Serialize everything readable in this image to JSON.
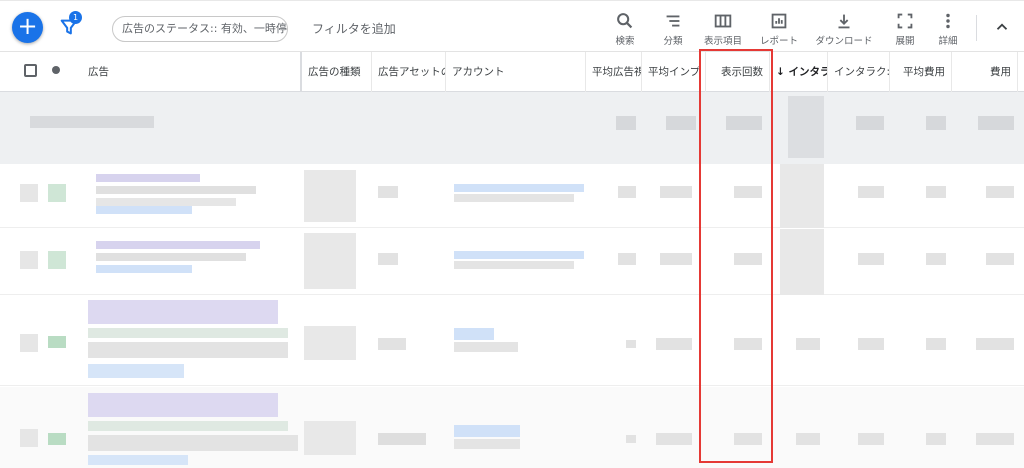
{
  "toolbar": {
    "add_icon": "plus-icon",
    "filter_badge": "1",
    "status_filter": "広告のステータス:: 有効、一時停止",
    "add_filter": "フィルタを追加",
    "tools": [
      {
        "label": "検索",
        "icon": "search-icon"
      },
      {
        "label": "分類",
        "icon": "segment-icon"
      },
      {
        "label": "表示項目",
        "icon": "columns-icon"
      },
      {
        "label": "レポート",
        "icon": "report-icon"
      },
      {
        "label": "ダウンロード",
        "icon": "download-icon"
      },
      {
        "label": "展開",
        "icon": "expand-icon"
      },
      {
        "label": "詳細",
        "icon": "more-icon"
      }
    ]
  },
  "table": {
    "columns": [
      {
        "label": "広告"
      },
      {
        "label": "広告の種類"
      },
      {
        "label": "広告アセットの"
      },
      {
        "label": "アカウント"
      },
      {
        "label": "平均広告視聴"
      },
      {
        "label": "平均インプ"
      },
      {
        "label": "表示回数"
      },
      {
        "label": "↓ インタラ"
      },
      {
        "label": "インタラク:"
      },
      {
        "label": "平均費用"
      },
      {
        "label": "費用"
      }
    ]
  },
  "colors": {
    "accent": "#1a73e8",
    "highlight": "#e53935",
    "total_row_bg": "#eef0f2"
  }
}
